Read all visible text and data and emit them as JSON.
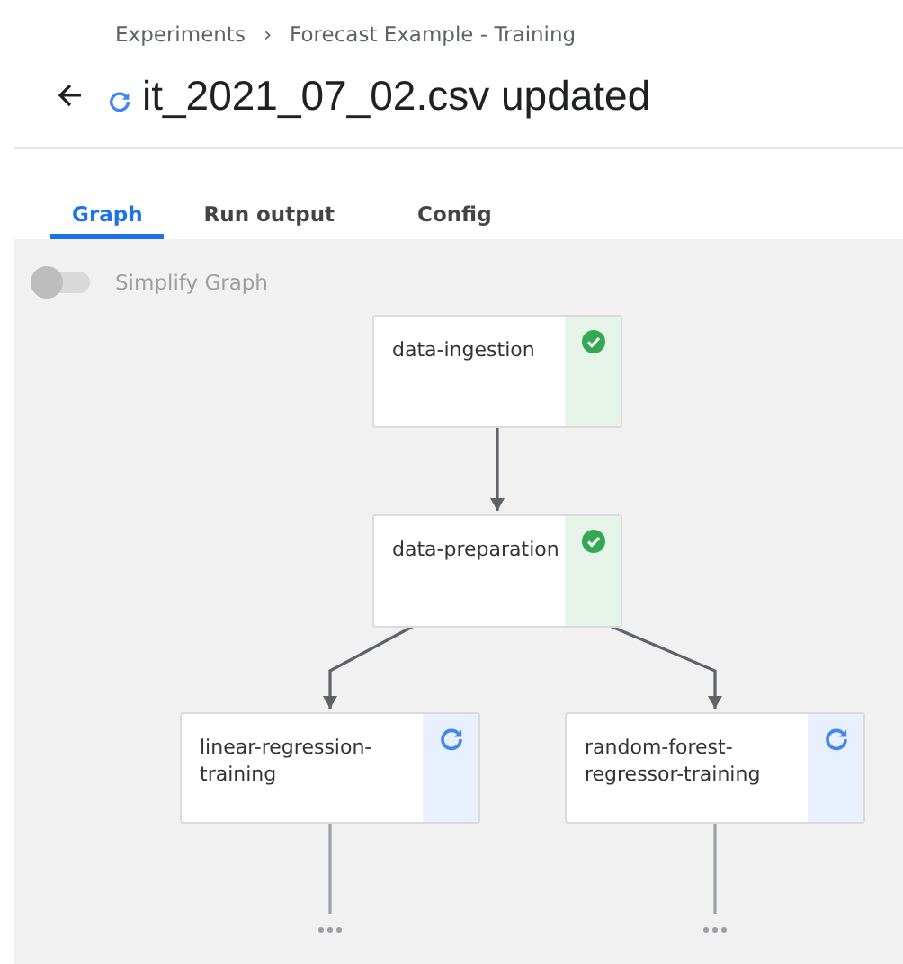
{
  "breadcrumbs": [
    "Experiments",
    "Forecast Example - Training"
  ],
  "breadcrumb_separator": "›",
  "title": {
    "text": "it_2021_07_02.csv updated",
    "running": true
  },
  "tabs": [
    {
      "label": "Graph",
      "selected": true
    },
    {
      "label": "Run output",
      "selected": false
    },
    {
      "label": "Config",
      "selected": false
    }
  ],
  "simplify_graph": {
    "label": "Simplify Graph",
    "on": false
  },
  "graph": {
    "nodes": [
      {
        "name": "data-ingestion",
        "kind": "succeeded",
        "children": [
          {
            "name": "data-preparation",
            "kind": "succeeded",
            "children": [
              {
                "name": "linear-regression-training",
                "kind": "running",
                "truncated": true
              },
              {
                "name": "random-forest-regressor-training",
                "kind": "running",
                "truncated": true
              }
            ]
          }
        ]
      }
    ]
  }
}
